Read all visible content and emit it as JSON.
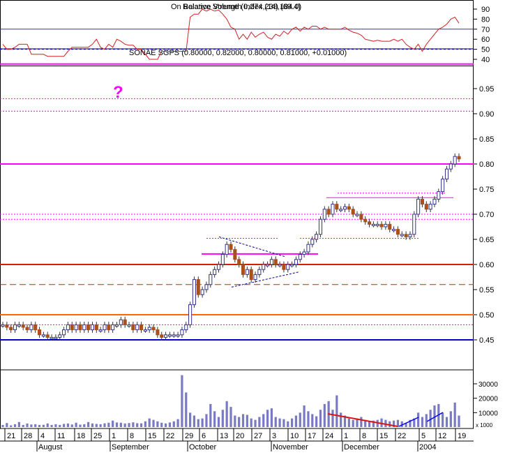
{
  "colors": {
    "up_candle": "#33338a",
    "down_candle": "#a8511d",
    "rsi_line": "#d42020",
    "volume_bar": "#7a7ac4",
    "magenta": "#ff00ff",
    "red_line": "#cc2200",
    "orange_line": "#ff6600",
    "blue_line": "#0000cc",
    "grid": "#000000"
  },
  "indicator_panel": {
    "title": "Relative Strength Index (14) (69.4)",
    "title_overlay": "On Balance Volume (0,274,238,184.0)",
    "y_ticks": [
      "90",
      "80",
      "70",
      "60",
      "50",
      "40"
    ],
    "levels": [
      70,
      50
    ]
  },
  "price_panel": {
    "title": "SONAE SGPS (0.80000, 0.82000, 0.80000, 0.81000, +0.01000)",
    "question_mark": "?",
    "y_ticks": [
      "0.95",
      "0.90",
      "0.85",
      "0.80",
      "0.75",
      "0.70",
      "0.65",
      "0.60",
      "0.55",
      "0.50",
      "0.45"
    ],
    "horizontal_levels": [
      {
        "value": 0.999,
        "color": "magenta",
        "style": "solid"
      },
      {
        "value": 0.93,
        "color": "magenta",
        "style": "dotted"
      },
      {
        "value": 0.905,
        "color": "magenta",
        "style": "dotted"
      },
      {
        "value": 0.8,
        "color": "magenta",
        "style": "solid"
      },
      {
        "value": 0.7,
        "color": "magenta",
        "style": "dotted"
      },
      {
        "value": 0.69,
        "color": "magenta",
        "style": "dotted"
      },
      {
        "value": 0.6,
        "color": "red_line",
        "style": "solid"
      },
      {
        "value": 0.56,
        "color": "red_line",
        "style": "dashed"
      },
      {
        "value": 0.5,
        "color": "orange_line",
        "style": "solid"
      },
      {
        "value": 0.48,
        "color": "magenta",
        "style": "dotted"
      },
      {
        "value": 0.45,
        "color": "blue_line",
        "style": "solid"
      }
    ]
  },
  "volume_panel": {
    "y_ticks": [
      "30000",
      "20000",
      "10000"
    ],
    "unit_label": "x 1000"
  },
  "x_axis": {
    "day_labels": [
      "21",
      "28",
      "4",
      "11",
      "18",
      "25",
      "1",
      "8",
      "15",
      "22",
      "29",
      "6",
      "13",
      "20",
      "27",
      "3",
      "10",
      "17",
      "24",
      "1",
      "8",
      "15",
      "22",
      "5",
      "12",
      "19"
    ],
    "month_labels": [
      "August",
      "September",
      "October",
      "November",
      "December",
      "2004"
    ]
  },
  "chart_data": {
    "type": "candlestick",
    "title": "SONAE SGPS",
    "last_bar": {
      "open": 0.8,
      "high": 0.82,
      "low": 0.8,
      "close": 0.81,
      "change": 0.01
    },
    "ylim": [
      0.42,
      1.0
    ],
    "volume_ylim": [
      0,
      37000
    ],
    "rsi_ylim": [
      33,
      95
    ],
    "series": [
      {
        "name": "close",
        "values": [
          0.48,
          0.475,
          0.47,
          0.48,
          0.48,
          0.475,
          0.47,
          0.48,
          0.47,
          0.46,
          0.46,
          0.455,
          0.455,
          0.455,
          0.46,
          0.47,
          0.48,
          0.47,
          0.48,
          0.47,
          0.48,
          0.47,
          0.48,
          0.47,
          0.47,
          0.48,
          0.47,
          0.48,
          0.48,
          0.49,
          0.48,
          0.48,
          0.47,
          0.48,
          0.47,
          0.47,
          0.475,
          0.47,
          0.46,
          0.455,
          0.46,
          0.46,
          0.46,
          0.46,
          0.47,
          0.48,
          0.52,
          0.57,
          0.54,
          0.55,
          0.56,
          0.58,
          0.59,
          0.6,
          0.62,
          0.64,
          0.63,
          0.61,
          0.6,
          0.58,
          0.59,
          0.57,
          0.58,
          0.59,
          0.6,
          0.6,
          0.61,
          0.6,
          0.6,
          0.59,
          0.6,
          0.6,
          0.61,
          0.62,
          0.625,
          0.64,
          0.65,
          0.66,
          0.69,
          0.71,
          0.7,
          0.72,
          0.71,
          0.71,
          0.715,
          0.71,
          0.7,
          0.7,
          0.69,
          0.685,
          0.68,
          0.68,
          0.68,
          0.675,
          0.68,
          0.67,
          0.67,
          0.66,
          0.66,
          0.655,
          0.66,
          0.7,
          0.73,
          0.72,
          0.71,
          0.72,
          0.73,
          0.745,
          0.77,
          0.79,
          0.8,
          0.815,
          0.81
        ]
      },
      {
        "name": "volume",
        "values": [
          1500,
          2800,
          1200,
          2000,
          3500,
          1500,
          2500,
          1800,
          2000,
          1500,
          1600,
          2500,
          1500,
          2000,
          1500,
          2200,
          2500,
          1800,
          3000,
          1700,
          2000,
          3500,
          2500,
          2200,
          2000,
          2600,
          3000,
          4500,
          3200,
          3000,
          2500,
          2800,
          3300,
          2700,
          2600,
          4000,
          6000,
          5000,
          4000,
          3000,
          2500,
          3200,
          4000,
          5500,
          36000,
          24000,
          10000,
          8000,
          5500,
          6000,
          9000,
          16000,
          11000,
          7000,
          12000,
          18000,
          14000,
          8000,
          7000,
          9000,
          8500,
          6000,
          5000,
          7000,
          9000,
          12000,
          13000,
          7000,
          6000,
          5500,
          4000,
          6000,
          8000,
          10000,
          15000,
          11000,
          9000,
          7500,
          12000,
          16000,
          18000,
          12000,
          22000,
          10000,
          8000,
          6000,
          5000,
          6000,
          7000,
          5000,
          4000,
          4500,
          5000,
          6000,
          5000,
          4000,
          4500,
          5000,
          4000,
          3000,
          5000,
          6000,
          10000,
          7000,
          9000,
          12000,
          15000,
          16000,
          10000,
          7000,
          11000,
          17000,
          8000
        ]
      },
      {
        "name": "rsi",
        "values": [
          55,
          50,
          50,
          52,
          55,
          55,
          55,
          45,
          45,
          45,
          45,
          43,
          43,
          43,
          43,
          43,
          48,
          52,
          52,
          52,
          52,
          52,
          55,
          60,
          52,
          50,
          55,
          52,
          60,
          58,
          55,
          54,
          54,
          50,
          50,
          45,
          40,
          40,
          40,
          48,
          48,
          48,
          48,
          48,
          48,
          48,
          82,
          85,
          85,
          90,
          88,
          90,
          88,
          89,
          85,
          80,
          72,
          70,
          60,
          65,
          60,
          67,
          62,
          65,
          67,
          62,
          60,
          65,
          63,
          68,
          65,
          70,
          72,
          68,
          72,
          70,
          73,
          73,
          70,
          72,
          70,
          70,
          70,
          70,
          72,
          69,
          67,
          66,
          64,
          60,
          59,
          58,
          59,
          58,
          58,
          58,
          60,
          58,
          60,
          55,
          52,
          50,
          55,
          48,
          55,
          60,
          65,
          70,
          72,
          75,
          80,
          82,
          76
        ]
      }
    ],
    "annotations": [
      "triangle pattern October-November",
      "volume divergence line late November-December",
      "volume rising trend lines December-January"
    ]
  }
}
